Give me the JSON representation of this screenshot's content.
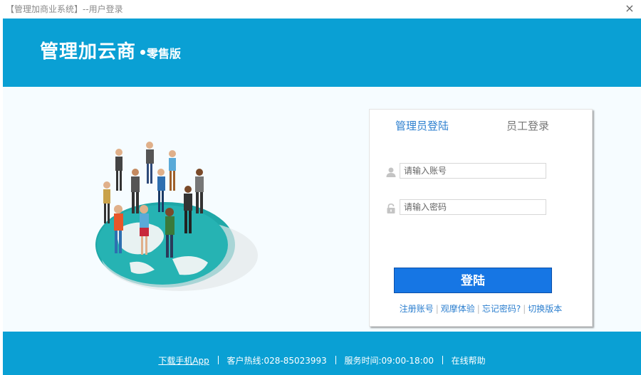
{
  "window": {
    "title": "【管理加商业系统】--用户登录",
    "close_icon": "×"
  },
  "brand": {
    "name": "管理加云商",
    "edition": "零售版"
  },
  "login": {
    "tabs": [
      {
        "label": "管理员登陆",
        "active": true
      },
      {
        "label": "员工登录",
        "active": false
      }
    ],
    "username_placeholder": "请输入账号",
    "password_placeholder": "请输入密码",
    "submit_label": "登陆",
    "links": [
      "注册账号",
      "观摩体验",
      "忘记密码?",
      "切换版本"
    ]
  },
  "footer": {
    "app_link": "下载手机App",
    "hotline": "客户热线:028-85023993",
    "service_hours": "服务时间:09:00-18:00",
    "help": "在线帮助"
  },
  "colors": {
    "header": "#0aa0d4",
    "accent": "#2c7fcf",
    "button": "#1676e4"
  }
}
